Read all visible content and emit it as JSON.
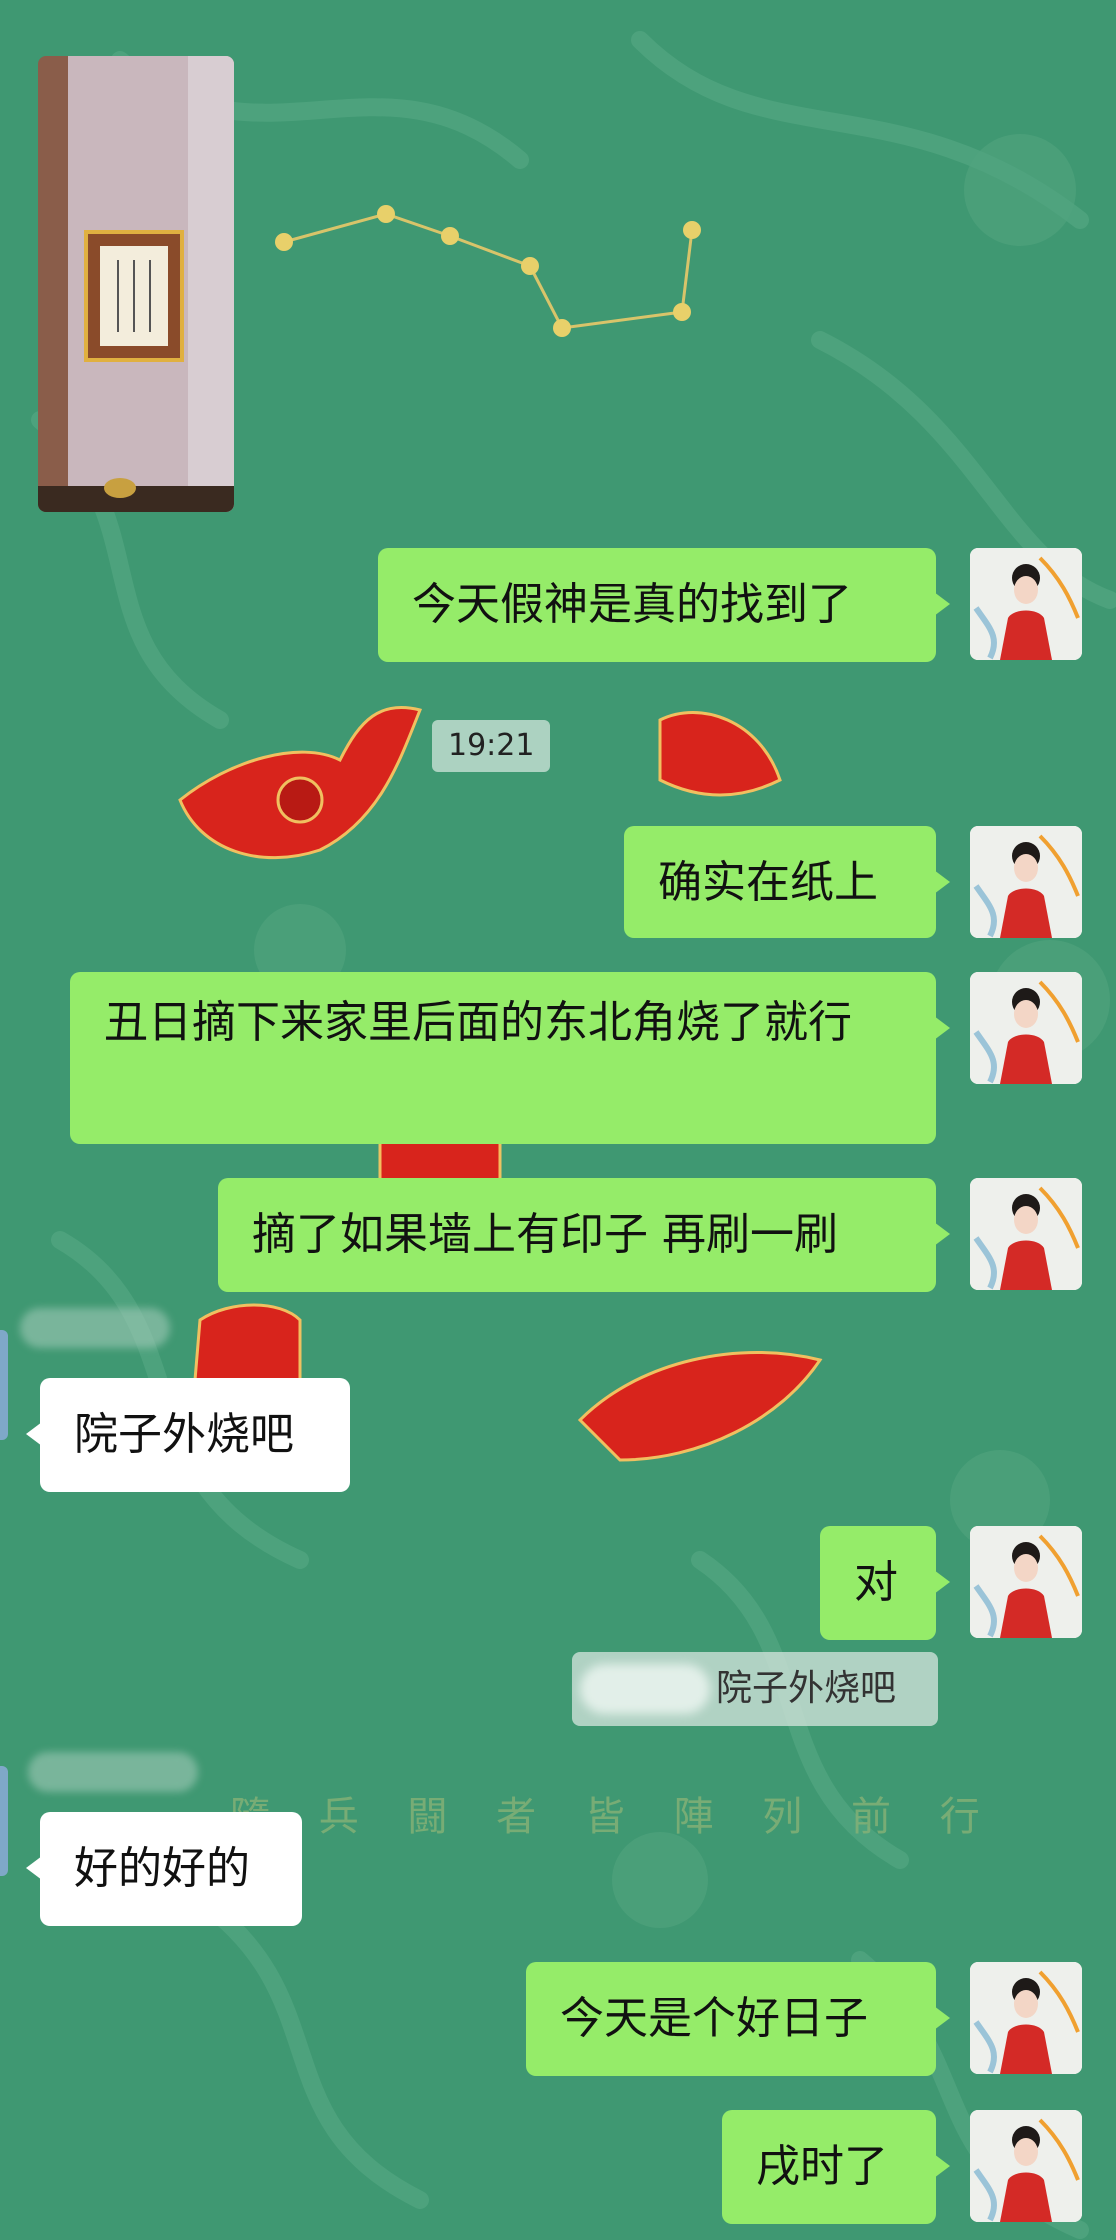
{
  "chat": {
    "timestamp": "19:21",
    "messages": [
      {
        "text": "今天假神是真的找到了"
      },
      {
        "text": "确实在纸上"
      },
      {
        "text": "丑日摘下来家里后面的东北角烧了就行"
      },
      {
        "text": "摘了如果墙上有印子 再刷一刷"
      },
      {
        "text": "院子外烧吧"
      },
      {
        "text": "对"
      },
      {
        "text": "好的好的"
      },
      {
        "text": "今天是个好日子"
      },
      {
        "text": "戌时了"
      }
    ],
    "quoted_reply": "院子外烧吧"
  },
  "background": {
    "calligraphy": "隨 兵 闘 者 皆 陣 列 前 行"
  },
  "colors": {
    "chat_bg": "#3f9872",
    "outgoing_bubble": "#95ec69",
    "incoming_bubble": "#ffffff",
    "red_motif": "#d8241c"
  }
}
